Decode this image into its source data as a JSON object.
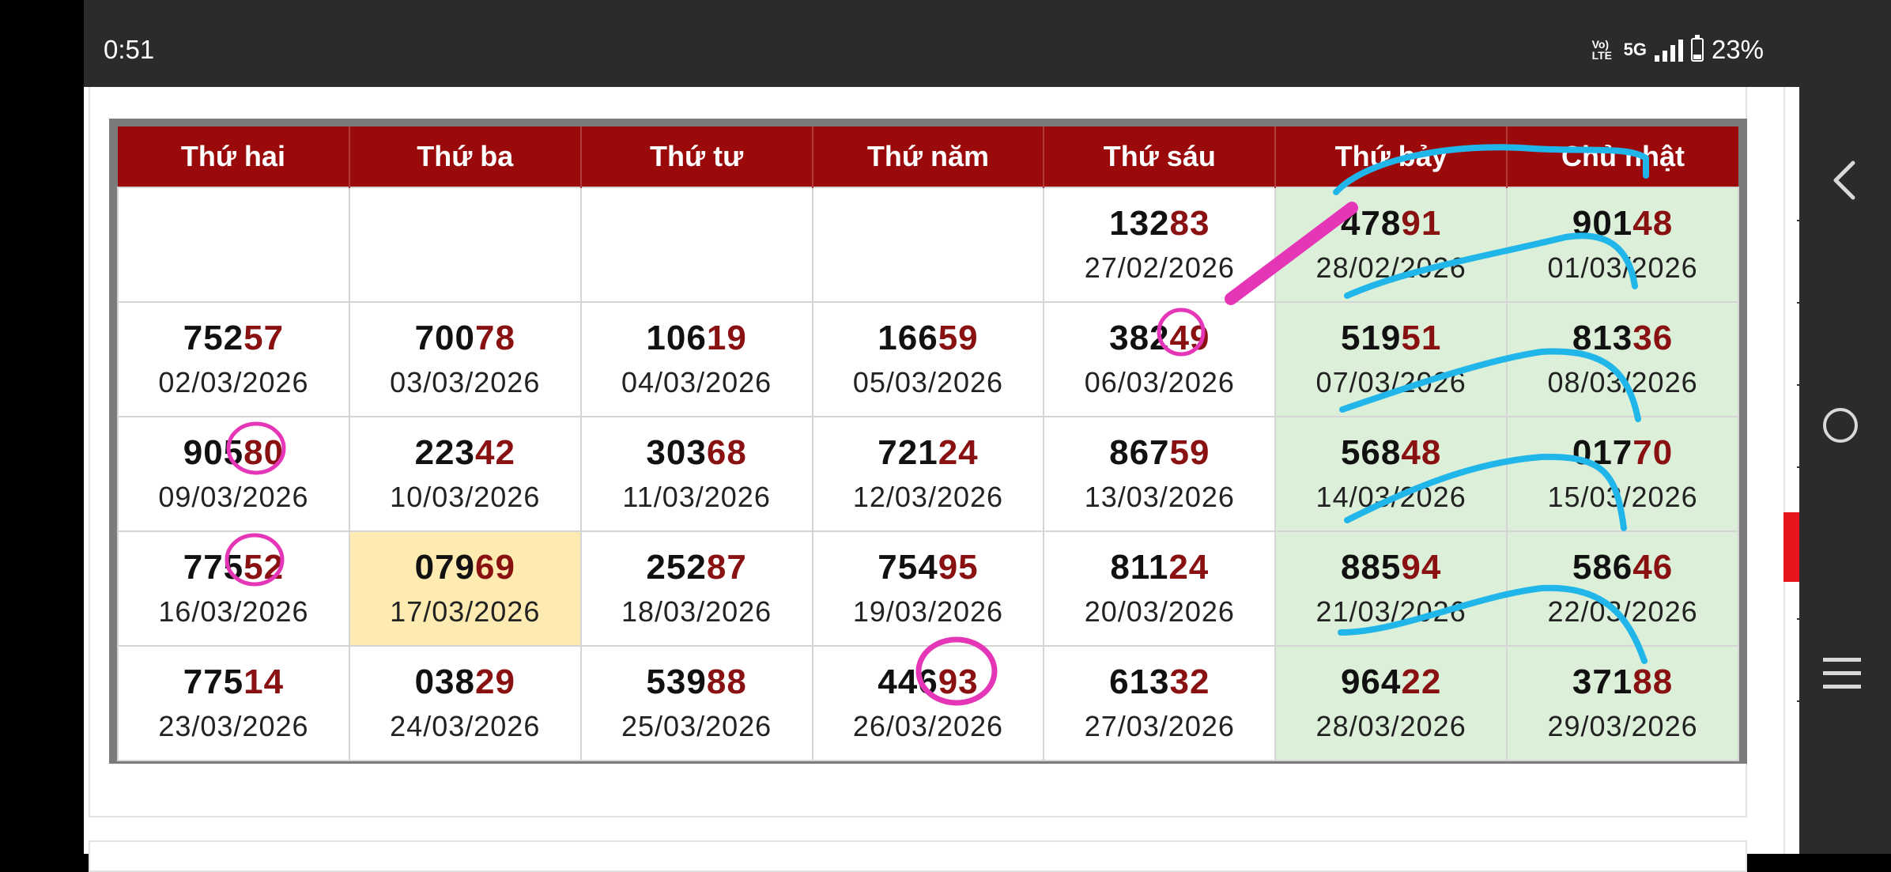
{
  "status_bar": {
    "time": "0:51",
    "volte": "Vo) LTE",
    "network": "5G",
    "battery": "23%",
    "battery_level": 0.23
  },
  "calendar": {
    "headers": [
      "Thứ hai",
      "Thứ ba",
      "Thứ tư",
      "Thứ năm",
      "Thứ sáu",
      "Thứ bảy",
      "Chủ nhật"
    ],
    "rows": [
      [
        {
          "head": "",
          "tail": "",
          "date": ""
        },
        {
          "head": "",
          "tail": "",
          "date": ""
        },
        {
          "head": "",
          "tail": "",
          "date": ""
        },
        {
          "head": "",
          "tail": "",
          "date": ""
        },
        {
          "head": "132",
          "tail": "83",
          "date": "27/02/2026"
        },
        {
          "head": "478",
          "tail": "91",
          "date": "28/02/2026"
        },
        {
          "head": "901",
          "tail": "48",
          "date": "01/03/2026"
        }
      ],
      [
        {
          "head": "752",
          "tail": "57",
          "date": "02/03/2026"
        },
        {
          "head": "700",
          "tail": "78",
          "date": "03/03/2026"
        },
        {
          "head": "106",
          "tail": "19",
          "date": "04/03/2026"
        },
        {
          "head": "166",
          "tail": "59",
          "date": "05/03/2026"
        },
        {
          "head": "382",
          "tail": "49",
          "date": "06/03/2026"
        },
        {
          "head": "519",
          "tail": "51",
          "date": "07/03/2026"
        },
        {
          "head": "813",
          "tail": "36",
          "date": "08/03/2026"
        }
      ],
      [
        {
          "head": "905",
          "tail": "80",
          "date": "09/03/2026"
        },
        {
          "head": "223",
          "tail": "42",
          "date": "10/03/2026"
        },
        {
          "head": "303",
          "tail": "68",
          "date": "11/03/2026"
        },
        {
          "head": "721",
          "tail": "24",
          "date": "12/03/2026"
        },
        {
          "head": "867",
          "tail": "59",
          "date": "13/03/2026"
        },
        {
          "head": "568",
          "tail": "48",
          "date": "14/03/2026"
        },
        {
          "head": "017",
          "tail": "70",
          "date": "15/03/2026"
        }
      ],
      [
        {
          "head": "775",
          "tail": "52",
          "date": "16/03/2026"
        },
        {
          "head": "079",
          "tail": "69",
          "date": "17/03/2026"
        },
        {
          "head": "252",
          "tail": "87",
          "date": "18/03/2026"
        },
        {
          "head": "754",
          "tail": "95",
          "date": "19/03/2026"
        },
        {
          "head": "811",
          "tail": "24",
          "date": "20/03/2026"
        },
        {
          "head": "885",
          "tail": "94",
          "date": "21/03/2026"
        },
        {
          "head": "586",
          "tail": "46",
          "date": "22/03/2026"
        }
      ],
      [
        {
          "head": "775",
          "tail": "14",
          "date": "23/03/2026"
        },
        {
          "head": "038",
          "tail": "29",
          "date": "24/03/2026"
        },
        {
          "head": "539",
          "tail": "88",
          "date": "25/03/2026"
        },
        {
          "head": "446",
          "tail": "93",
          "date": "26/03/2026"
        },
        {
          "head": "613",
          "tail": "32",
          "date": "27/03/2026"
        },
        {
          "head": "964",
          "tail": "22",
          "date": "28/03/2026"
        },
        {
          "head": "371",
          "tail": "88",
          "date": "29/03/2026"
        }
      ]
    ],
    "today": "17/03/2026"
  },
  "colors": {
    "header_bg": "#9b0a0a",
    "tail_text": "#8a1111",
    "weekend_bg": "#dcefd8",
    "today_bg": "#fdebb1",
    "circle_ink": "#e636b8",
    "line_ink": "#21b6ea"
  },
  "nav": {
    "icons": [
      "back-icon",
      "home-icon",
      "recents-icon"
    ]
  }
}
